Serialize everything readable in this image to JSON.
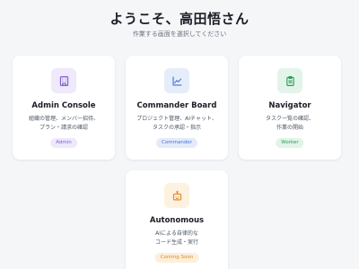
{
  "header": {
    "greeting": "ようこそ、高田悟さん",
    "subtitle": "作業する画面を選択してください"
  },
  "cards": [
    {
      "title": "Admin Console",
      "desc_lines": [
        "組織の管理、メンバー招待、",
        "プラン・請求の確認"
      ],
      "badge": "Admin",
      "icon": "building-icon",
      "colors": {
        "tile": "#efe9fb",
        "icon": "#7c5cd6",
        "badge_bg": "#efe8fb",
        "badge_fg": "#7c5cd6"
      }
    },
    {
      "title": "Commander Board",
      "desc_lines": [
        "プロジェクト管理、AIチャット、",
        "タスクの承認・指示"
      ],
      "badge": "Commander",
      "icon": "chart-line-icon",
      "colors": {
        "tile": "#e5edfb",
        "icon": "#4a72d4",
        "badge_bg": "#e3ebfb",
        "badge_fg": "#4a72d4"
      }
    },
    {
      "title": "Navigator",
      "desc_lines": [
        "タスク一覧の確認、",
        "作業の開始"
      ],
      "badge": "Worker",
      "icon": "clipboard-icon",
      "colors": {
        "tile": "#e3f5ea",
        "icon": "#2e9d5c",
        "badge_bg": "#e1f4e8",
        "badge_fg": "#2e9d5c"
      }
    },
    {
      "title": "Autonomous",
      "desc_lines": [
        "AIによる自律的な",
        "コード生成・実行"
      ],
      "badge": "Coming Soon",
      "icon": "robot-icon",
      "colors": {
        "tile": "#fdf1e0",
        "icon": "#e08a2a",
        "badge_bg": "#fdefd9",
        "badge_fg": "#d98a2b"
      }
    }
  ]
}
